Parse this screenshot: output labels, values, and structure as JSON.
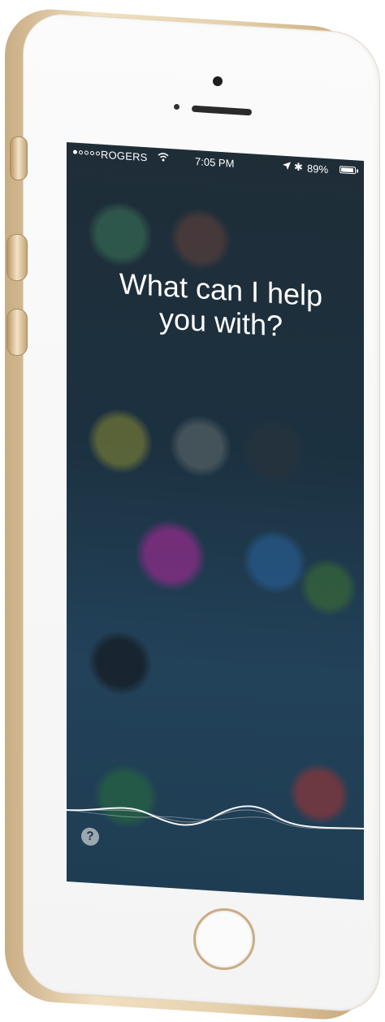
{
  "status_bar": {
    "carrier": "ROGERS",
    "time": "7:05 PM",
    "battery_percent": "89%",
    "battery_level": 0.89,
    "signal_bars_filled": 1,
    "signal_bars_total": 5,
    "icons": [
      "wifi-icon",
      "location-arrow-icon",
      "bluetooth-icon",
      "battery-icon"
    ]
  },
  "siri": {
    "prompt_line1": "What can I help",
    "prompt_line2": "you with?",
    "help_label": "?"
  },
  "colors": {
    "frame_gold": "#c9ad84",
    "face_white": "#fbfbfb",
    "screen_bg": "#1f3d52",
    "text": "#ffffff"
  }
}
